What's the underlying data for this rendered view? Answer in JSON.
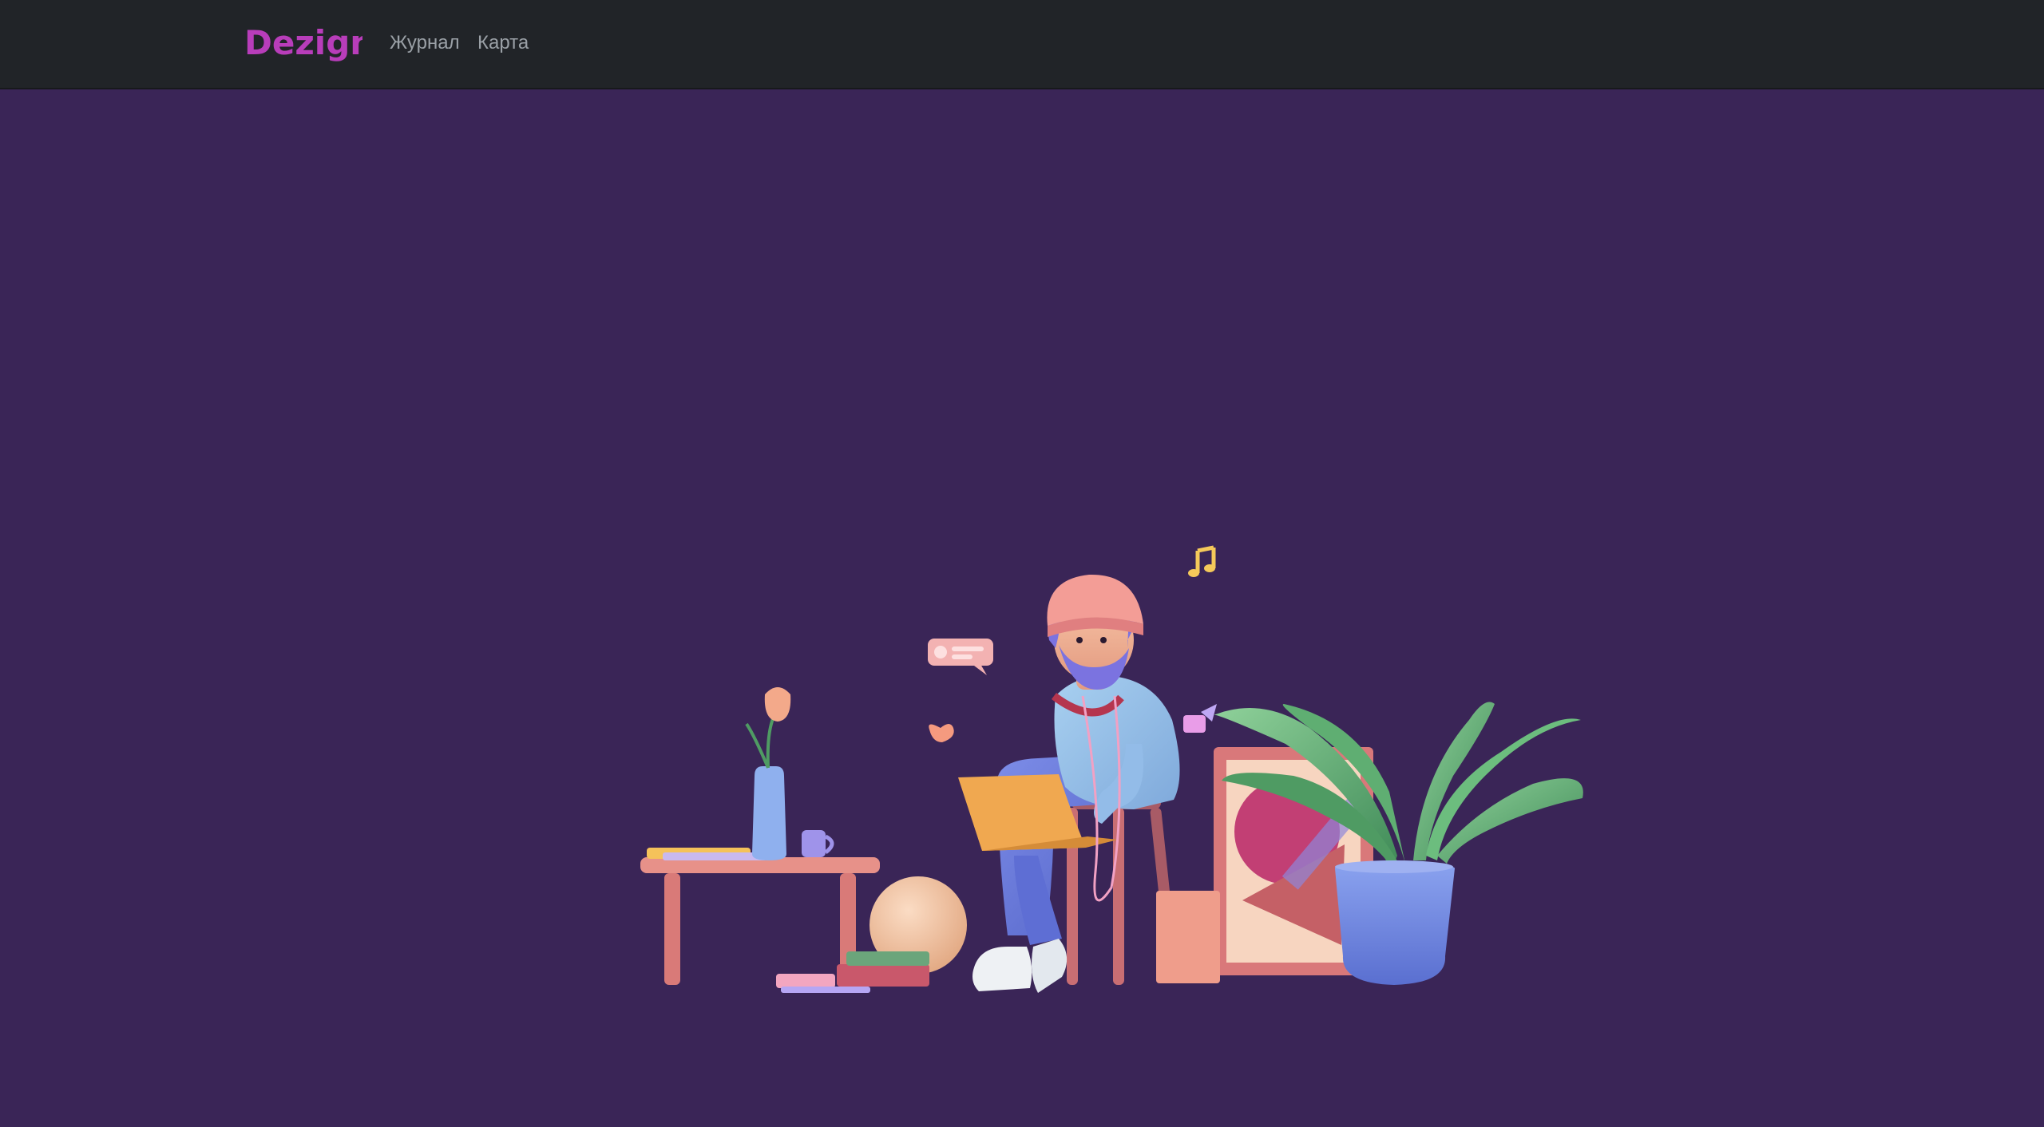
{
  "navbar": {
    "brand": {
      "logo": "Dezign",
      "color": "#b83dba"
    },
    "links": [
      {
        "label": "Журнал"
      },
      {
        "label": "Карта"
      }
    ],
    "background": "#212428"
  },
  "hero": {
    "background": "#3a2557",
    "illustration": "person-with-laptop-illustration"
  }
}
